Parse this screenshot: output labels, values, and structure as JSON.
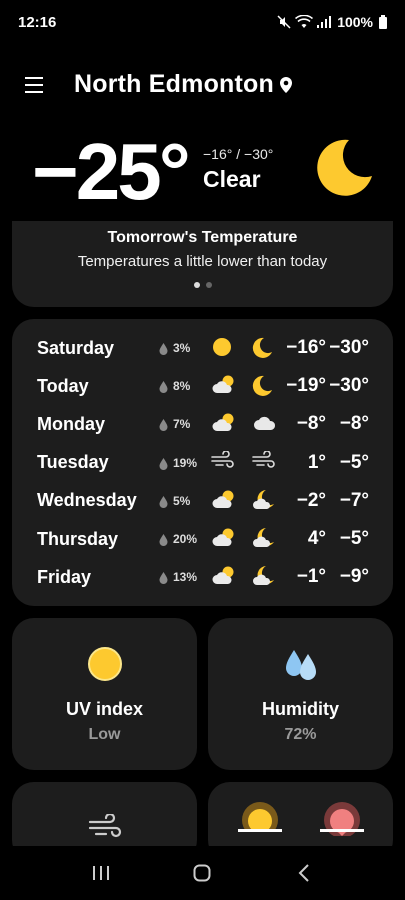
{
  "status_bar": {
    "time": "12:16",
    "battery": "100%"
  },
  "header": {
    "location": "North Edmonton"
  },
  "current": {
    "temp": "−25°",
    "hilo": "−16° / −30°",
    "condition": "Clear"
  },
  "tomorrow": {
    "title": "Tomorrow's Temperature",
    "text": "Temperatures a little lower than today",
    "page_count": 2,
    "active_page": 0
  },
  "forecast": [
    {
      "day": "Saturday",
      "precip": "3%",
      "icon_day": "sun-icon",
      "icon_night": "moon-icon",
      "hi": "−16°",
      "lo": "−30°"
    },
    {
      "day": "Today",
      "precip": "8%",
      "icon_day": "partly-cloudy-icon",
      "icon_night": "moon-icon",
      "hi": "−19°",
      "lo": "−30°"
    },
    {
      "day": "Monday",
      "precip": "7%",
      "icon_day": "partly-cloudy-icon",
      "icon_night": "cloud-icon",
      "hi": "−8°",
      "lo": "−8°"
    },
    {
      "day": "Tuesday",
      "precip": "19%",
      "icon_day": "wind-icon",
      "icon_night": "wind-icon",
      "hi": "1°",
      "lo": "−5°"
    },
    {
      "day": "Wednesday",
      "precip": "5%",
      "icon_day": "partly-cloudy-icon",
      "icon_night": "partly-cloudy-night-icon",
      "hi": "−2°",
      "lo": "−7°"
    },
    {
      "day": "Thursday",
      "precip": "20%",
      "icon_day": "partly-cloudy-icon",
      "icon_night": "partly-cloudy-night-icon",
      "hi": "4°",
      "lo": "−5°"
    },
    {
      "day": "Friday",
      "precip": "13%",
      "icon_day": "partly-cloudy-icon",
      "icon_night": "partly-cloudy-night-icon",
      "hi": "−1°",
      "lo": "−9°"
    }
  ],
  "uv": {
    "title": "UV index",
    "value": "Low",
    "icon": "sun-icon"
  },
  "humidity": {
    "title": "Humidity",
    "value": "72%",
    "icon": "droplets-icon"
  },
  "wind_card": {
    "icon": "wind-icon"
  },
  "sun_card": {
    "icons": [
      "sunrise-icon",
      "sunset-icon"
    ]
  },
  "colors": {
    "sun": "#fdc92f",
    "moon": "#fdc92f",
    "card": "#1d1d1d",
    "droplet": "#8ec6f2",
    "sunset": "#f08080"
  }
}
